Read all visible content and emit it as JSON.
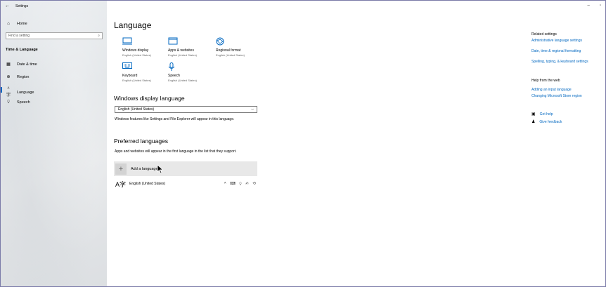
{
  "window": {
    "title": "Settings"
  },
  "sidebar": {
    "home_label": "Home",
    "search_placeholder": "Find a setting",
    "section": "Time & Language",
    "items": [
      {
        "icon": "calendar-clock-icon",
        "label": "Date & time"
      },
      {
        "icon": "globe-icon",
        "label": "Region"
      },
      {
        "icon": "language-icon",
        "label": "Language",
        "active": true
      },
      {
        "icon": "microphone-icon",
        "label": "Speech"
      }
    ]
  },
  "main": {
    "title": "Language",
    "tiles": [
      {
        "icon": "monitor-icon",
        "label": "Windows display",
        "sub": "English (United States)"
      },
      {
        "icon": "window-icon",
        "label": "Apps & websites",
        "sub": "English (United States)"
      },
      {
        "icon": "regional-format-icon",
        "label": "Regional format",
        "sub": "English (United States)"
      },
      {
        "icon": "keyboard-icon",
        "label": "Keyboard",
        "sub": "English (United States)"
      },
      {
        "icon": "microphone-icon",
        "label": "Speech",
        "sub": "English (United States)"
      }
    ],
    "display_section": {
      "heading": "Windows display language",
      "selected": "English (United States)",
      "description": "Windows features like Settings and File Explorer will appear in this language."
    },
    "preferred_section": {
      "heading": "Preferred languages",
      "description": "Apps and websites will appear in the first language in the list that they support.",
      "add_label": "Add a language",
      "languages": [
        {
          "name": "English (United States)"
        }
      ]
    }
  },
  "related": {
    "heading": "Related settings",
    "links": [
      "Administrative language settings",
      "Date, time & regional formatting",
      "Spelling, typing, & keyboard settings"
    ]
  },
  "help": {
    "heading": "Help from the web",
    "links": [
      "Adding an input language",
      "Changing Microsoft Store region"
    ]
  },
  "support": {
    "get_help": "Get help",
    "give_feedback": "Give feedback"
  },
  "colors": {
    "accent": "#0067c0"
  }
}
